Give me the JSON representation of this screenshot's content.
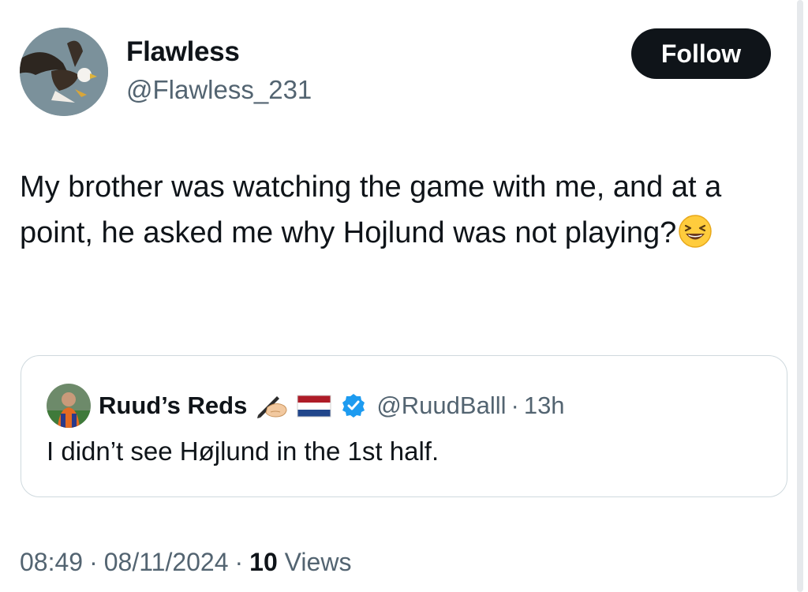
{
  "author": {
    "display_name": "Flawless",
    "handle": "@Flawless_231",
    "avatar_icon": "eagle-avatar"
  },
  "follow_button": {
    "label": "Follow"
  },
  "tweet": {
    "text": "My brother was watching the game with me, and at a point, he asked me why Hojlund was not playing?",
    "emoji": "laughing-squinting-face"
  },
  "quoted_tweet": {
    "display_name": "Ruud’s Reds",
    "name_icons": [
      "writing-hand-icon",
      "netherlands-flag-icon",
      "verified-badge-icon"
    ],
    "handle": "@RuudBalll",
    "separator": "·",
    "time": "13h",
    "text": "I didn’t see Højlund in the 1st half."
  },
  "meta": {
    "time": "08:49",
    "separator": "·",
    "date": "08/11/2024",
    "views_count": "10",
    "views_label": "Views"
  },
  "colors": {
    "text": "#0f1419",
    "secondary": "#536471",
    "border": "#cfd9de",
    "verified": "#1d9bf0"
  }
}
